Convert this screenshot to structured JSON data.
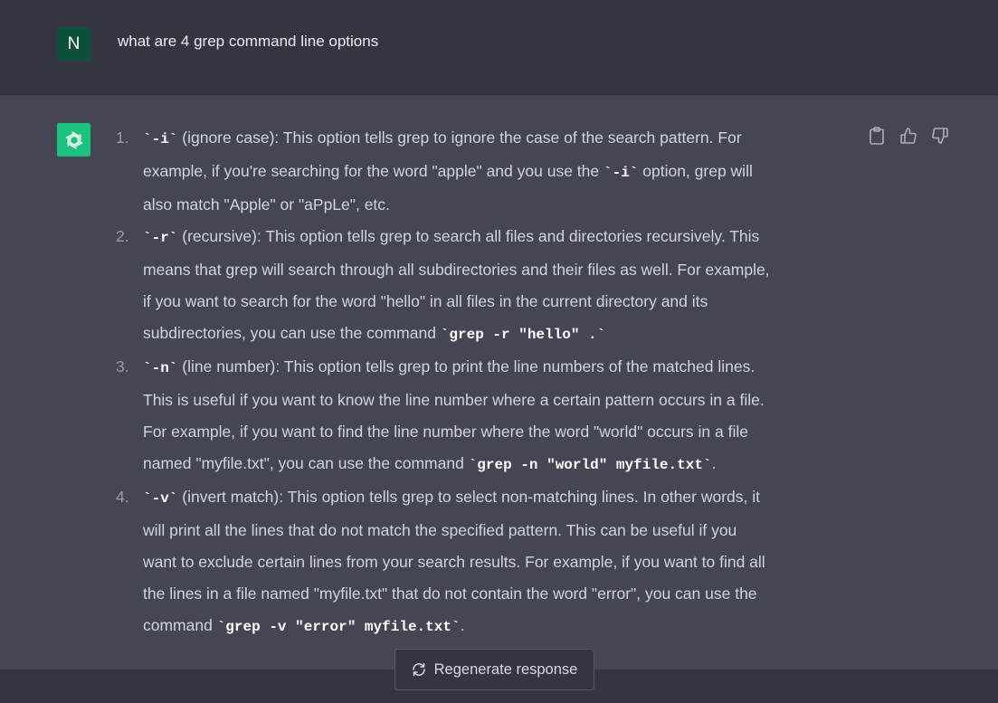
{
  "user_message": {
    "avatar_initial": "N",
    "text": "what are 4 grep command line options"
  },
  "assistant_message": {
    "items": [
      {
        "number": "1.",
        "option": "`-i`",
        "line1_rest": " (ignore case): This option tells grep to ignore the case of the search pattern. For",
        "line2_pre": "example, if you're searching for the word \"apple\" and you use the ",
        "line2_code": "`-i`",
        "line2_post": " option, grep will",
        "line3": "also match \"Apple\" or \"aPpLe\", etc."
      },
      {
        "number": "2.",
        "option": "`-r`",
        "line1_rest": " (recursive): This option tells grep to search all files and directories recursively. This",
        "line2": "means that grep will search through all subdirectories and their files as well. For example,",
        "line3": "if you want to search for the word \"hello\" in all files in the current directory and its",
        "line4_pre": "subdirectories, you can use the command ",
        "line4_code": "`grep -r \"hello\" .`"
      },
      {
        "number": "3.",
        "option": "`-n`",
        "line1_rest": " (line number): This option tells grep to print the line numbers of the matched lines.",
        "line2": "This is useful if you want to know the line number where a certain pattern occurs in a file.",
        "line3": "For example, if you want to find the line number where the word \"world\" occurs in a file",
        "line4_pre": "named \"myfile.txt\", you can use the command ",
        "line4_code": "`grep -n \"world\" myfile.txt`",
        "line4_post": "."
      },
      {
        "number": "4.",
        "option": "`-v`",
        "line1_rest": " (invert match): This option tells grep to select non-matching lines. In other words, it",
        "line2": "will print all the lines that do not match the specified pattern. This can be useful if you",
        "line3": "want to exclude certain lines from your search results. For example, if you want to find all",
        "line4": "the lines in a file named \"myfile.txt\" that do not contain the word \"error\", you can use the",
        "line5_pre": "command ",
        "line5_code": "`grep -v \"error\" myfile.txt`",
        "line5_post": "."
      }
    ],
    "icons": [
      "clipboard-icon",
      "thumbs-up-icon",
      "thumbs-down-icon"
    ]
  },
  "regenerate": {
    "label": "Regenerate response",
    "icon": "refresh-icon"
  },
  "colors": {
    "user_bg": "#343541",
    "assistant_bg": "#444654",
    "bot_avatar": "#19c37d",
    "user_avatar": "#0b4f3c"
  }
}
